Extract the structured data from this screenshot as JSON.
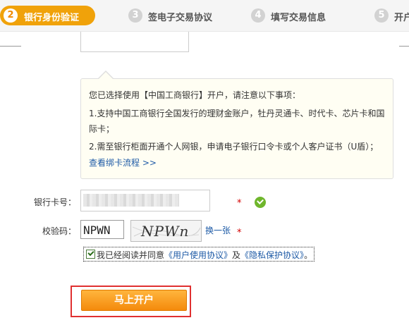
{
  "steps": [
    {
      "num": "2",
      "label": "银行身份验证",
      "active": true
    },
    {
      "num": "3",
      "label": "签电子交易协议"
    },
    {
      "num": "4",
      "label": "填写交易信息"
    },
    {
      "num": "5",
      "label": "开户"
    }
  ],
  "notice": {
    "line1": "您已选择使用【中国工商银行】开户，请注意以下事项：",
    "line2": "1.支持中国工商银行全国发行的理财金账户，牡丹灵通卡、时代卡、芯片卡和国",
    "line3": "际卡；",
    "line4": "2.需至银行柜面开通个人网银，申请电子银行口令卡或个人客户证书（U盾）；",
    "link": "查看绑卡流程 >>"
  },
  "form": {
    "card_label": "银行卡号：",
    "code_label": "校验码：",
    "code_value": "NPWN",
    "captcha_text": "NPWn",
    "refresh_label": "换一张",
    "required_mark": "*",
    "card_valid": true
  },
  "agree": {
    "checked": true,
    "prefix": "我已经阅读并同意",
    "link1": "《用户使用协议》",
    "mid": "及",
    "link2": "《隐私保护协议》",
    "suffix": "。"
  },
  "submit_label": "马上开户",
  "colors": {
    "accent": "#f0a20a",
    "link": "#1d5aa6",
    "required": "#d40000"
  }
}
